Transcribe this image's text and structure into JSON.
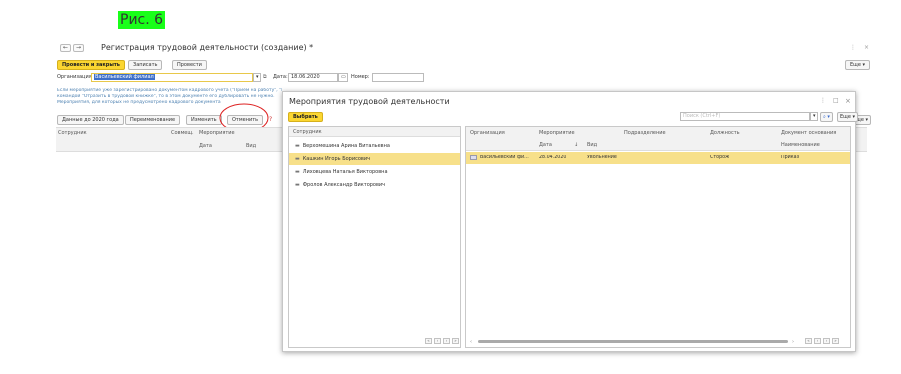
{
  "figure_label": "Рис. 6",
  "window": {
    "back": "←",
    "forward": "→",
    "title": "Регистрация трудовой деятельности (создание) *",
    "more_icon": "⋮",
    "close_icon": "×",
    "more_label": "Еще ▾"
  },
  "toolbar": {
    "post_close": "Провести и закрыть",
    "save": "Записать",
    "post": "Провести"
  },
  "form": {
    "org_label": "Организация:",
    "org_value": "Васильевский филиал",
    "date_label": "Дата:",
    "date_value": "18.06.2020",
    "number_label": "Номер:",
    "number_value": "",
    "info_lines": [
      "Если мероприятие уже зарегистрировано документом кадрового учета (\"Прием на работу\", \"Перевод\", \"Увольнение\" и т.п.)",
      "командой \"Отразить в трудовой книжке\", то в этом документе его дублировать не нужно.",
      "Мероприятия, для которых не предусмотрено кадрового документа"
    ]
  },
  "subtoolbar": {
    "data_before_2020": "Данные до 2020 года",
    "rename": "Переименование",
    "change": "Изменить",
    "cancel": "Отменить",
    "help": "?",
    "more_label": "Еще ▾"
  },
  "main_table": {
    "col_employee": "Сотрудник",
    "col_combine": "Совмещ.",
    "col_event": "Мероприятие",
    "sub_date": "Дата",
    "sub_kind": "Вид"
  },
  "modal": {
    "title": "Мероприятия трудовой деятельности",
    "more_icon": "⋮",
    "maximize_icon": "□",
    "close_icon": "×",
    "select_button": "Выбрать",
    "search_placeholder": "Поиск (Ctrl+F)",
    "search_icon": "🔍",
    "more_label": "Еще ▾",
    "employees_header": "Сотрудник",
    "employees": [
      {
        "name": "Верхомешина Арина Витальевна",
        "selected": false
      },
      {
        "name": "Кашкин Игорь Борисович",
        "selected": true
      },
      {
        "name": "Лиховцева Наталья Викторовна",
        "selected": false
      },
      {
        "name": "Фролов Александр Викторович",
        "selected": false
      }
    ],
    "events_header": {
      "organization": "Организация",
      "event": "Мероприятие",
      "event_date": "Дата",
      "sort_icon": "↓",
      "event_kind": "Вид",
      "department": "Подразделение",
      "position": "Должность",
      "basis_doc": "Документ основания",
      "basis_name": "Наименование"
    },
    "events": [
      {
        "organization": "Васильевский фи...",
        "date": "28.04.2020",
        "kind": "Увольнение",
        "department": "",
        "position": "Сторож",
        "basis_name": "Приказ"
      }
    ],
    "nav_first": "«",
    "nav_prev": "‹",
    "nav_next": "›",
    "nav_last": "»"
  },
  "colors": {
    "accent_yellow": "#fbd631",
    "selection": "#f7e08a",
    "figure_bg": "#19ff19",
    "annotation_red": "#d22"
  }
}
